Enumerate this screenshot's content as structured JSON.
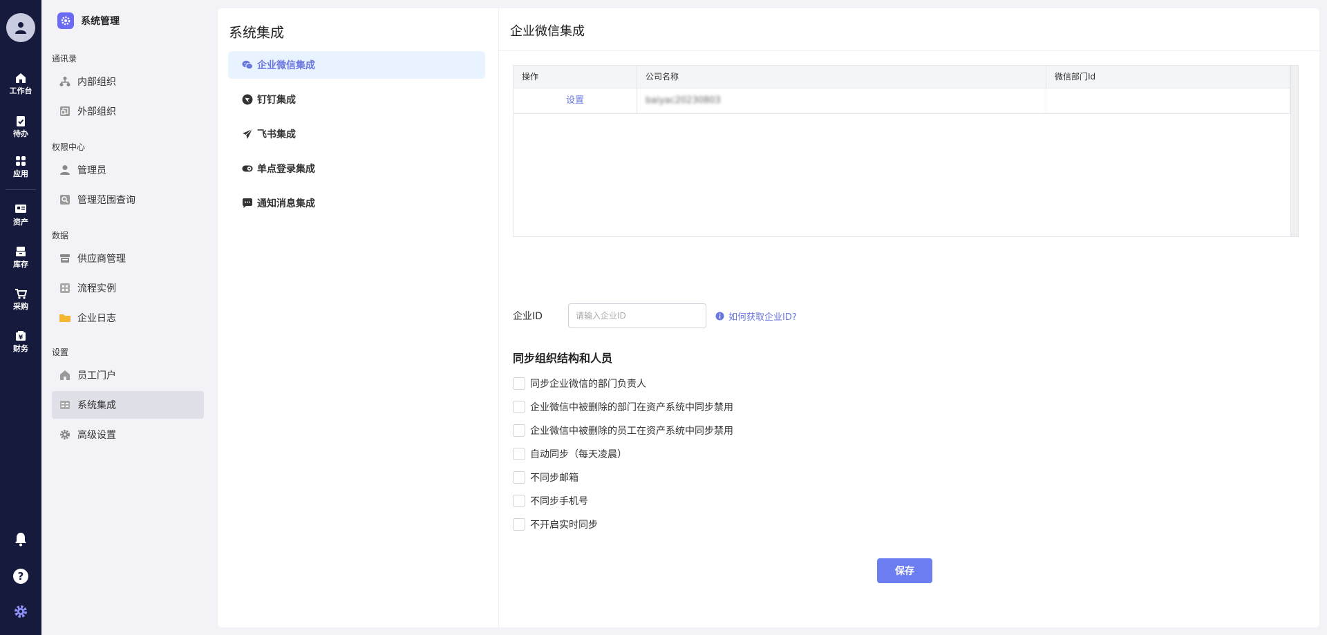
{
  "rail": {
    "items": [
      {
        "label": "工作台",
        "icon": "home-icon"
      },
      {
        "label": "待办",
        "icon": "clipboard-check-icon"
      },
      {
        "label": "应用",
        "icon": "apps-grid-icon"
      },
      {
        "label": "资产",
        "icon": "asset-card-icon"
      },
      {
        "label": "库存",
        "icon": "inventory-icon"
      },
      {
        "label": "采购",
        "icon": "shopping-cart-icon"
      },
      {
        "label": "财务",
        "icon": "finance-icon"
      }
    ],
    "bottom_icons": [
      "bell-icon",
      "help-icon",
      "settings-gear-icon"
    ]
  },
  "sidebar": {
    "title": "系统管理",
    "groups": [
      {
        "label": "通讯录",
        "items": [
          {
            "label": "内部组织"
          },
          {
            "label": "外部组织"
          }
        ]
      },
      {
        "label": "权限中心",
        "items": [
          {
            "label": "管理员"
          },
          {
            "label": "管理范围查询"
          }
        ]
      },
      {
        "label": "数据",
        "items": [
          {
            "label": "供应商管理"
          },
          {
            "label": "流程实例"
          },
          {
            "label": "企业日志"
          }
        ]
      },
      {
        "label": "设置",
        "items": [
          {
            "label": "员工门户"
          },
          {
            "label": "系统集成",
            "active": true
          },
          {
            "label": "高级设置"
          }
        ]
      }
    ]
  },
  "integration": {
    "title": "系统集成",
    "items": [
      {
        "label": "企业微信集成",
        "active": true
      },
      {
        "label": "钉钉集成"
      },
      {
        "label": "飞书集成"
      },
      {
        "label": "单点登录集成"
      },
      {
        "label": "通知消息集成"
      }
    ]
  },
  "detail": {
    "title": "企业微信集成",
    "table": {
      "columns": [
        "操作",
        "公司名称",
        "微信部门Id"
      ],
      "rows": [
        {
          "action": "设置",
          "company": "baiyac20230803",
          "dept_id": ""
        }
      ]
    },
    "corp_id": {
      "label": "企业ID",
      "placeholder": "请输入企业ID",
      "value": "",
      "help": "如何获取企业ID?"
    },
    "sync": {
      "title": "同步组织结构和人员",
      "options": [
        {
          "label": "同步企业微信的部门负责人",
          "checked": false
        },
        {
          "label": "企业微信中被删除的部门在资产系统中同步禁用",
          "checked": false
        },
        {
          "label": "企业微信中被删除的员工在资产系统中同步禁用",
          "checked": false
        },
        {
          "label": "自动同步（每天凌晨）",
          "checked": false
        },
        {
          "label": "不同步邮箱",
          "checked": false
        },
        {
          "label": "不同步手机号",
          "checked": false
        },
        {
          "label": "不开启实时同步",
          "checked": false
        }
      ]
    },
    "save_label": "保存"
  },
  "colors": {
    "rail_bg": "#161a3d",
    "accent": "#6b77e0",
    "save_button": "#6b7df0",
    "active_integration_bg": "#e9f2ff",
    "folder_icon": "#f5b731"
  }
}
